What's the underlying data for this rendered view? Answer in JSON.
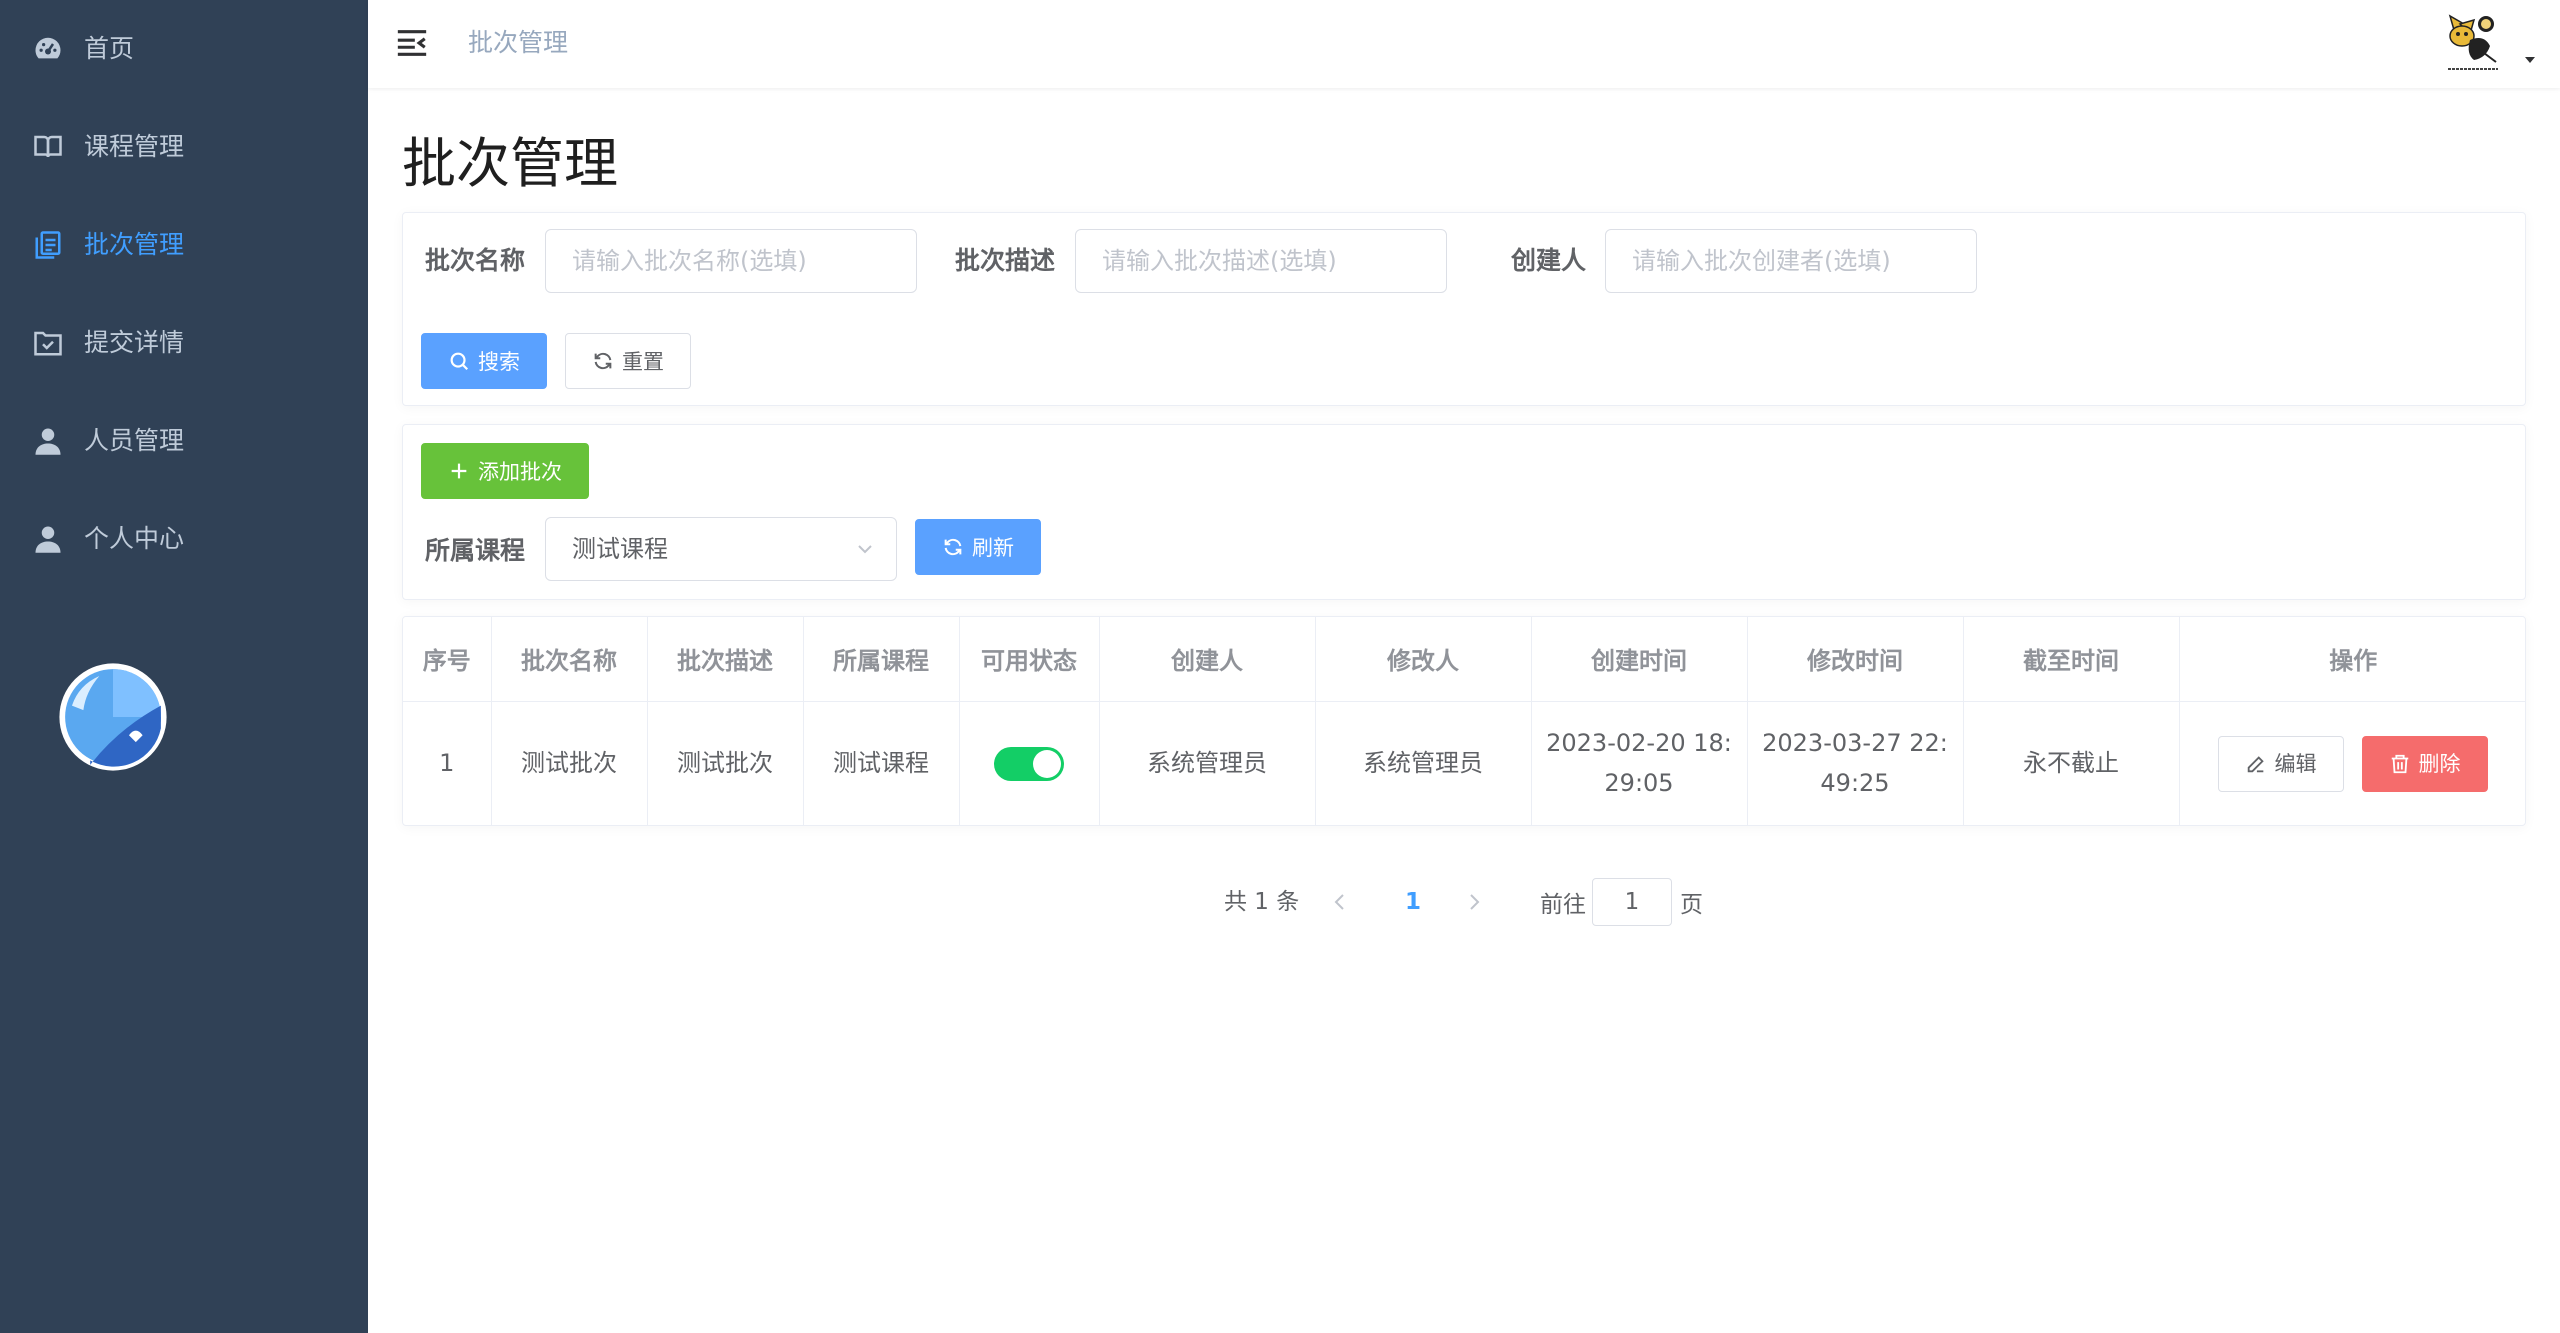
{
  "sidebar": {
    "items": [
      {
        "label": "首页",
        "icon": "dashboard-icon"
      },
      {
        "label": "课程管理",
        "icon": "book-icon"
      },
      {
        "label": "批次管理",
        "icon": "batch-icon",
        "active": true
      },
      {
        "label": "提交详情",
        "icon": "inbox-check-icon"
      },
      {
        "label": "人员管理",
        "icon": "user-icon"
      },
      {
        "label": "个人中心",
        "icon": "user-icon"
      }
    ],
    "bg_color": "#304156",
    "active_color": "#409eff"
  },
  "header": {
    "breadcrumb": "批次管理",
    "avatar_icon": "tomcat-avatar-icon"
  },
  "page": {
    "title": "批次管理"
  },
  "search": {
    "name_label": "批次名称",
    "name_placeholder": "请输入批次名称(选填)",
    "desc_label": "批次描述",
    "desc_placeholder": "请输入批次描述(选填)",
    "creator_label": "创建人",
    "creator_placeholder": "请输入批次创建者(选填)",
    "search_button": "搜索",
    "reset_button": "重置"
  },
  "actions": {
    "add_button": "添加批次",
    "course_label": "所属课程",
    "course_selected": "测试课程",
    "refresh_button": "刷新"
  },
  "table": {
    "columns": [
      "序号",
      "批次名称",
      "批次描述",
      "所属课程",
      "可用状态",
      "创建人",
      "修改人",
      "创建时间",
      "修改时间",
      "截至时间",
      "操作"
    ],
    "rows": [
      {
        "index": "1",
        "name": "测试批次",
        "desc": "测试批次",
        "course": "测试课程",
        "enabled": true,
        "creator": "系统管理员",
        "modifier": "系统管理员",
        "created_line1": "2023-02-20 18:",
        "created_line2": "29:05",
        "modified_line1": "2023-03-27 22:",
        "modified_line2": "49:25",
        "deadline": "永不截止",
        "edit_button": "编辑",
        "delete_button": "删除"
      }
    ]
  },
  "pagination": {
    "total": "共 1 条",
    "current_page": "1",
    "goto_label": "前往",
    "goto_value": "1",
    "page_suffix": "页"
  },
  "colors": {
    "primary": "#5aa1ff",
    "success": "#67c23a",
    "danger": "#f56c6c",
    "switch_on": "#13ce66"
  }
}
